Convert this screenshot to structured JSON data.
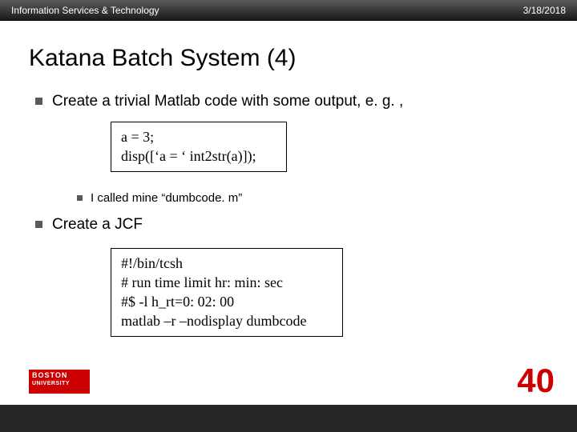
{
  "header": {
    "org": "Information Services & Technology",
    "date": "3/18/2018"
  },
  "title": "Katana Batch System (4)",
  "bullets": {
    "b1": "Create a trivial Matlab code with some output, e. g. ,",
    "code1_l1": "a = 3;",
    "code1_l2": "disp([‘a = ‘ int2str(a)]);",
    "b2": "I called mine “dumbcode. m”",
    "b3": "Create a JCF",
    "code2_l1": "#!/bin/tcsh",
    "code2_l2": "# run time limit hr: min: sec",
    "code2_l3": "#$ -l h_rt=0: 02: 00",
    "code2_l4": "matlab –r –nodisplay dumbcode"
  },
  "logo": {
    "line1": "BOSTON",
    "line2": "UNIVERSITY"
  },
  "page": "40"
}
